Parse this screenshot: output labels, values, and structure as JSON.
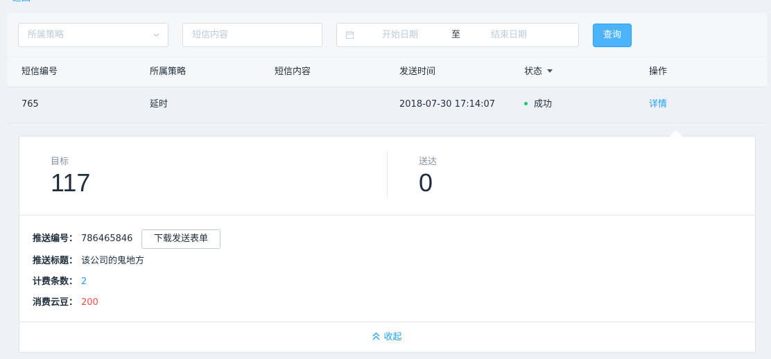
{
  "top_link": "返回",
  "filters": {
    "strategy_placeholder": "所属策略",
    "content_placeholder": "短信内容",
    "date_start_placeholder": "开始日期",
    "date_separator": "至",
    "date_end_placeholder": "结束日期",
    "query_label": "查询"
  },
  "table": {
    "headers": [
      "短信编号",
      "所属策略",
      "短信内容",
      "发送时间",
      "状态",
      "操作"
    ],
    "rows": [
      {
        "id": "765",
        "strategy": "延时",
        "content": "",
        "send_time": "2018-07-30 17:14:07",
        "status": "成功",
        "action": "详情"
      }
    ]
  },
  "detail": {
    "target_label": "目标",
    "target_value": "117",
    "reached_label": "送达",
    "reached_value": "0",
    "push_id_label": "推送编号：",
    "push_id_value": "786465846",
    "download_label": "下载发送表单",
    "push_title_label": "推送标题：",
    "push_title_value": "该公司的鬼地方",
    "billing_count_label": "计费条数：",
    "billing_count_value": "2",
    "cost_label": "消费云豆：",
    "cost_value": "200",
    "collapse_label": "收起"
  },
  "colors": {
    "primary": "#20a0ff",
    "success": "#13ce66",
    "danger": "#ff4949"
  },
  "icons": {
    "strategy_select": "chevron-down-icon",
    "date_range": "calendar-icon",
    "sort": "caret-down-icon",
    "collapse": "double-chevron-up-icon"
  }
}
